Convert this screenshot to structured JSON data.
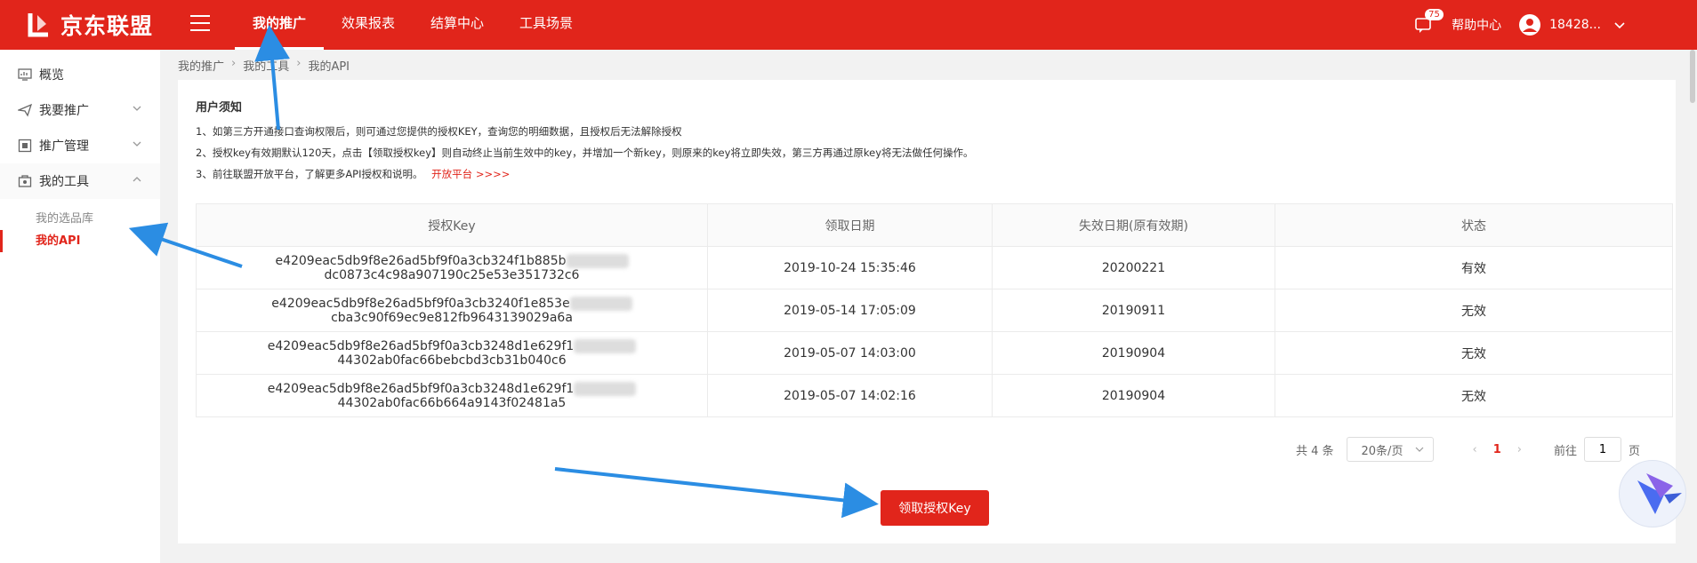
{
  "brand": {
    "name": "京东联盟",
    "color": "#e1251b"
  },
  "topnav": {
    "items": [
      "我的推广",
      "效果报表",
      "结算中心",
      "工具场景"
    ],
    "active_index": 0,
    "badge_count": "75",
    "help_label": "帮助中心",
    "username": "18428..."
  },
  "sidebar": {
    "items": [
      {
        "label": "概览",
        "icon": "dashboard-icon"
      },
      {
        "label": "我要推广",
        "icon": "send-icon"
      },
      {
        "label": "推广管理",
        "icon": "manage-icon"
      },
      {
        "label": "我的工具",
        "icon": "tools-icon"
      }
    ],
    "sub_items": [
      "我的选品库",
      "我的API"
    ],
    "active_sub": "我的API"
  },
  "breadcrumb": [
    "我的推广",
    "我的工具",
    "我的API"
  ],
  "notice": {
    "title": "用户须知",
    "lines": [
      "1、如第三方开通接口查询权限后，则可通过您提供的授权KEY，查询您的明细数据，且授权后无法解除授权",
      "2、授权key有效期默认120天，点击【领取授权key】则自动终止当前生效中的key，并增加一个新key，则原来的key将立即失效，第三方再通过原key将无法做任何操作。",
      "3、前往联盟开放平台，了解更多API授权和说明。"
    ],
    "link_text": "开放平台 >>>>"
  },
  "table": {
    "headers": [
      "授权Key",
      "领取日期",
      "失效日期(原有效期)",
      "状态"
    ],
    "rows": [
      {
        "key_a": "e4209eac5db9f8e26ad5bf9f0a3cb324f1b885b",
        "key_b": "dc0873c4c98a907190c25e53e351732c6",
        "date": "2019-10-24 15:35:46",
        "expire": "20200221",
        "status": "有效"
      },
      {
        "key_a": "e4209eac5db9f8e26ad5bf9f0a3cb3240f1e853e",
        "key_b": "cba3c90f69ec9e812fb9643139029a6a",
        "date": "2019-05-14 17:05:09",
        "expire": "20190911",
        "status": "无效"
      },
      {
        "key_a": "e4209eac5db9f8e26ad5bf9f0a3cb3248d1e629f1",
        "key_b": "44302ab0fac66bebcbd3cb31b040c6",
        "date": "2019-05-07 14:03:00",
        "expire": "20190904",
        "status": "无效"
      },
      {
        "key_a": "e4209eac5db9f8e26ad5bf9f0a3cb3248d1e629f1",
        "key_b": "44302ab0fac66b664a9143f02481a5",
        "date": "2019-05-07 14:02:16",
        "expire": "20190904",
        "status": "无效"
      }
    ]
  },
  "pagination": {
    "total": "共 4 条",
    "page_size": "20条/页",
    "current_page": "1",
    "goto_label": "前往",
    "goto_value": "1",
    "page_suffix": "页"
  },
  "action_button": "领取授权Key"
}
